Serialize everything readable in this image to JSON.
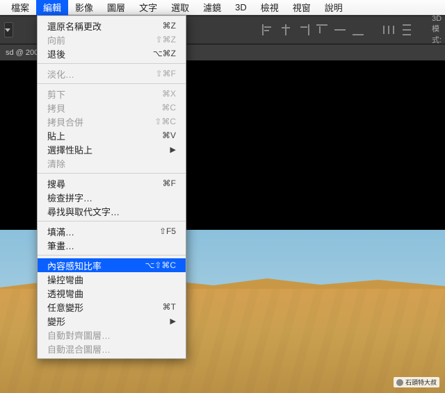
{
  "menubar": {
    "items": [
      "檔案",
      "編輯",
      "影像",
      "圖層",
      "文字",
      "選取",
      "濾鏡",
      "3D",
      "檢視",
      "視窗",
      "說明"
    ],
    "selected_index": 1
  },
  "optionsbar": {
    "mode3d_label": "3D 模式:"
  },
  "doc_tab": "sd @ 200",
  "watermark": "石頭特大叔",
  "menu": {
    "groups": [
      [
        {
          "label": "還原名稱更改",
          "shortcut": "⌘Z",
          "enabled": true,
          "sub": false,
          "highlight": false
        },
        {
          "label": "向前",
          "shortcut": "⇧⌘Z",
          "enabled": false,
          "sub": false,
          "highlight": false
        },
        {
          "label": "退後",
          "shortcut": "⌥⌘Z",
          "enabled": true,
          "sub": false,
          "highlight": false
        }
      ],
      [
        {
          "label": "淡化…",
          "shortcut": "⇧⌘F",
          "enabled": false,
          "sub": false,
          "highlight": false
        }
      ],
      [
        {
          "label": "剪下",
          "shortcut": "⌘X",
          "enabled": false,
          "sub": false,
          "highlight": false
        },
        {
          "label": "拷貝",
          "shortcut": "⌘C",
          "enabled": false,
          "sub": false,
          "highlight": false
        },
        {
          "label": "拷貝合併",
          "shortcut": "⇧⌘C",
          "enabled": false,
          "sub": false,
          "highlight": false
        },
        {
          "label": "貼上",
          "shortcut": "⌘V",
          "enabled": true,
          "sub": false,
          "highlight": false
        },
        {
          "label": "選擇性貼上",
          "shortcut": "",
          "enabled": true,
          "sub": true,
          "highlight": false
        },
        {
          "label": "清除",
          "shortcut": "",
          "enabled": false,
          "sub": false,
          "highlight": false
        }
      ],
      [
        {
          "label": "搜尋",
          "shortcut": "⌘F",
          "enabled": true,
          "sub": false,
          "highlight": false
        },
        {
          "label": "檢查拼字…",
          "shortcut": "",
          "enabled": true,
          "sub": false,
          "highlight": false
        },
        {
          "label": "尋找與取代文字…",
          "shortcut": "",
          "enabled": true,
          "sub": false,
          "highlight": false
        }
      ],
      [
        {
          "label": "填滿…",
          "shortcut": "⇧F5",
          "enabled": true,
          "sub": false,
          "highlight": false
        },
        {
          "label": "筆畫…",
          "shortcut": "",
          "enabled": true,
          "sub": false,
          "highlight": false
        }
      ],
      [
        {
          "label": "內容感知比率",
          "shortcut": "⌥⇧⌘C",
          "enabled": true,
          "sub": false,
          "highlight": true
        },
        {
          "label": "操控彎曲",
          "shortcut": "",
          "enabled": true,
          "sub": false,
          "highlight": false
        },
        {
          "label": "透視彎曲",
          "shortcut": "",
          "enabled": true,
          "sub": false,
          "highlight": false
        },
        {
          "label": "任意變形",
          "shortcut": "⌘T",
          "enabled": true,
          "sub": false,
          "highlight": false
        },
        {
          "label": "變形",
          "shortcut": "",
          "enabled": true,
          "sub": true,
          "highlight": false
        },
        {
          "label": "自動對齊圖層…",
          "shortcut": "",
          "enabled": false,
          "sub": false,
          "highlight": false
        },
        {
          "label": "自動混合圖層…",
          "shortcut": "",
          "enabled": false,
          "sub": false,
          "highlight": false
        }
      ]
    ]
  }
}
